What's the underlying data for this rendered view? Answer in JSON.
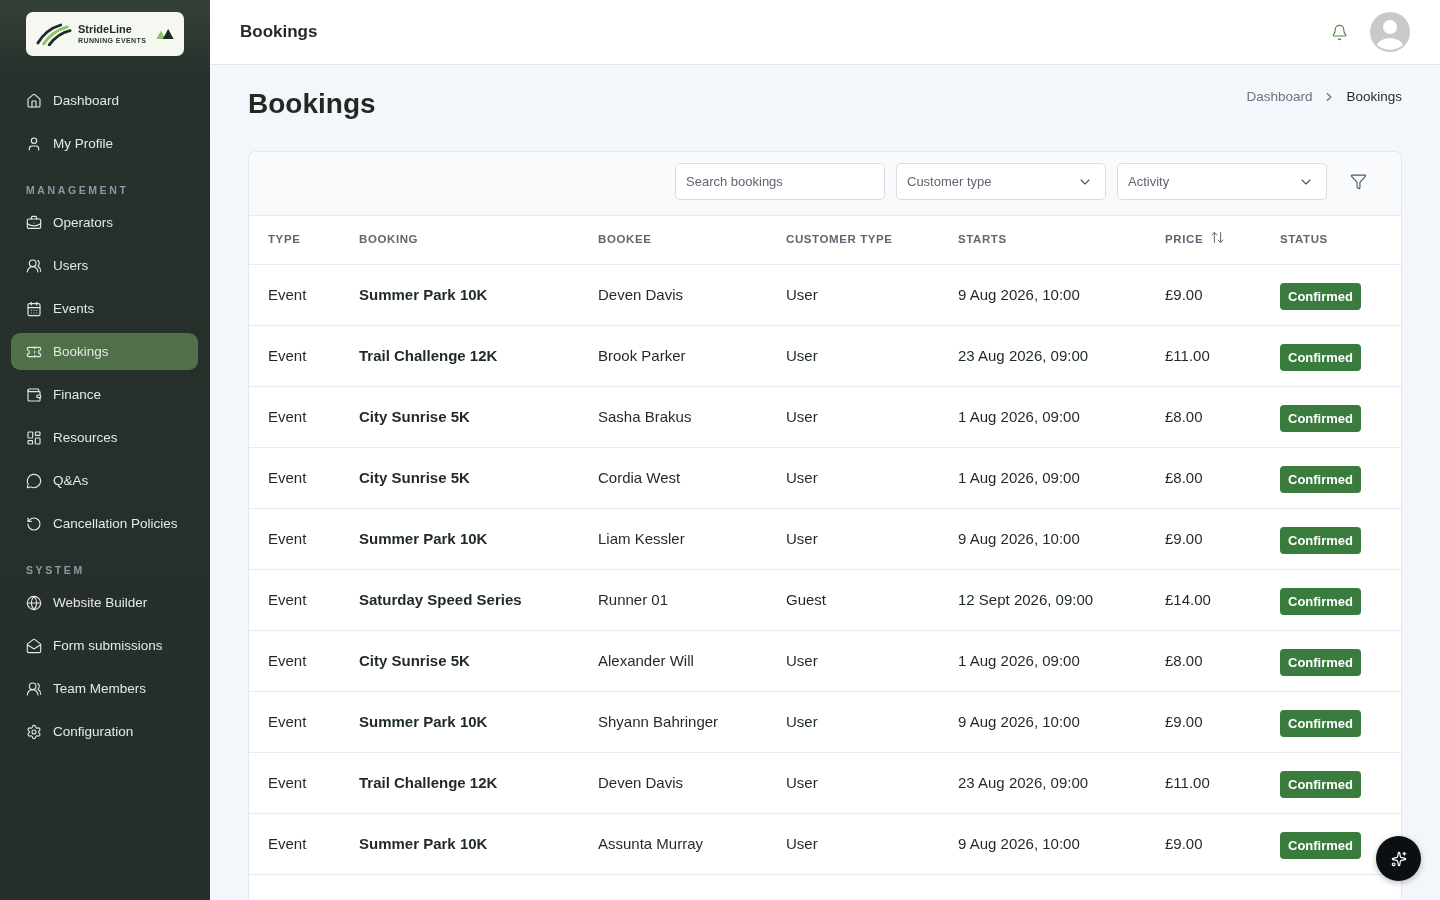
{
  "sidebar": {
    "logo": {
      "name": "StrideLine",
      "tagline": "RUNNING EVENTS"
    },
    "items": [
      {
        "kind": "link",
        "label": "Dashboard",
        "selected": false
      },
      {
        "kind": "link",
        "label": "My Profile",
        "selected": false
      },
      {
        "kind": "heading",
        "label": "MANAGEMENT"
      },
      {
        "kind": "link",
        "label": "Operators",
        "selected": false
      },
      {
        "kind": "link",
        "label": "Users",
        "selected": false
      },
      {
        "kind": "link",
        "label": "Events",
        "selected": false
      },
      {
        "kind": "link",
        "label": "Bookings",
        "selected": true
      },
      {
        "kind": "link",
        "label": "Finance",
        "selected": false
      },
      {
        "kind": "link",
        "label": "Resources",
        "selected": false
      },
      {
        "kind": "link",
        "label": "Q&As",
        "selected": false
      },
      {
        "kind": "link",
        "label": "Cancellation Policies",
        "selected": false
      },
      {
        "kind": "heading",
        "label": "SYSTEM"
      },
      {
        "kind": "link",
        "label": "Website Builder",
        "selected": false
      },
      {
        "kind": "link",
        "label": "Form submissions",
        "selected": false
      },
      {
        "kind": "link",
        "label": "Team Members",
        "selected": false
      },
      {
        "kind": "link",
        "label": "Configuration",
        "selected": false
      }
    ]
  },
  "topbar": {
    "title": "Bookings"
  },
  "page": {
    "title": "Bookings",
    "breadcrumb": [
      {
        "label": "Dashboard",
        "current": false
      },
      {
        "label": "Bookings",
        "current": true
      }
    ]
  },
  "toolbar": {
    "search": {
      "placeholder": "Search bookings"
    },
    "filters": [
      {
        "label": "Customer type"
      },
      {
        "label": "Activity"
      }
    ]
  },
  "table": {
    "columns": [
      {
        "label": "TYPE",
        "sortable": false
      },
      {
        "label": "BOOKING",
        "sortable": false
      },
      {
        "label": "BOOKEE",
        "sortable": false
      },
      {
        "label": "CUSTOMER TYPE",
        "sortable": false
      },
      {
        "label": "STARTS",
        "sortable": false
      },
      {
        "label": "PRICE",
        "sortable": true
      },
      {
        "label": "STATUS",
        "sortable": false
      }
    ],
    "rows": [
      {
        "type": "Event",
        "booking": "Summer Park 10K",
        "bookee": "Deven Davis",
        "customer_type": "User",
        "starts": "9 Aug 2026, 10:00",
        "price": "£9.00",
        "status": "Confirmed"
      },
      {
        "type": "Event",
        "booking": "Trail Challenge 12K",
        "bookee": "Brook Parker",
        "customer_type": "User",
        "starts": "23 Aug 2026, 09:00",
        "price": "£11.00",
        "status": "Confirmed"
      },
      {
        "type": "Event",
        "booking": "City Sunrise 5K",
        "bookee": "Sasha Brakus",
        "customer_type": "User",
        "starts": "1 Aug 2026, 09:00",
        "price": "£8.00",
        "status": "Confirmed"
      },
      {
        "type": "Event",
        "booking": "City Sunrise 5K",
        "bookee": "Cordia West",
        "customer_type": "User",
        "starts": "1 Aug 2026, 09:00",
        "price": "£8.00",
        "status": "Confirmed"
      },
      {
        "type": "Event",
        "booking": "Summer Park 10K",
        "bookee": "Liam Kessler",
        "customer_type": "User",
        "starts": "9 Aug 2026, 10:00",
        "price": "£9.00",
        "status": "Confirmed"
      },
      {
        "type": "Event",
        "booking": "Saturday Speed Series",
        "bookee": "Runner 01",
        "customer_type": "Guest",
        "starts": "12 Sept 2026, 09:00",
        "price": "£14.00",
        "status": "Confirmed"
      },
      {
        "type": "Event",
        "booking": "City Sunrise 5K",
        "bookee": "Alexander Will",
        "customer_type": "User",
        "starts": "1 Aug 2026, 09:00",
        "price": "£8.00",
        "status": "Confirmed"
      },
      {
        "type": "Event",
        "booking": "Summer Park 10K",
        "bookee": "Shyann Bahringer",
        "customer_type": "User",
        "starts": "9 Aug 2026, 10:00",
        "price": "£9.00",
        "status": "Confirmed"
      },
      {
        "type": "Event",
        "booking": "Trail Challenge 12K",
        "bookee": "Deven Davis",
        "customer_type": "User",
        "starts": "23 Aug 2026, 09:00",
        "price": "£11.00",
        "status": "Confirmed"
      },
      {
        "type": "Event",
        "booking": "Summer Park 10K",
        "bookee": "Assunta Murray",
        "customer_type": "User",
        "starts": "9 Aug 2026, 10:00",
        "price": "£9.00",
        "status": "Confirmed"
      }
    ]
  }
}
